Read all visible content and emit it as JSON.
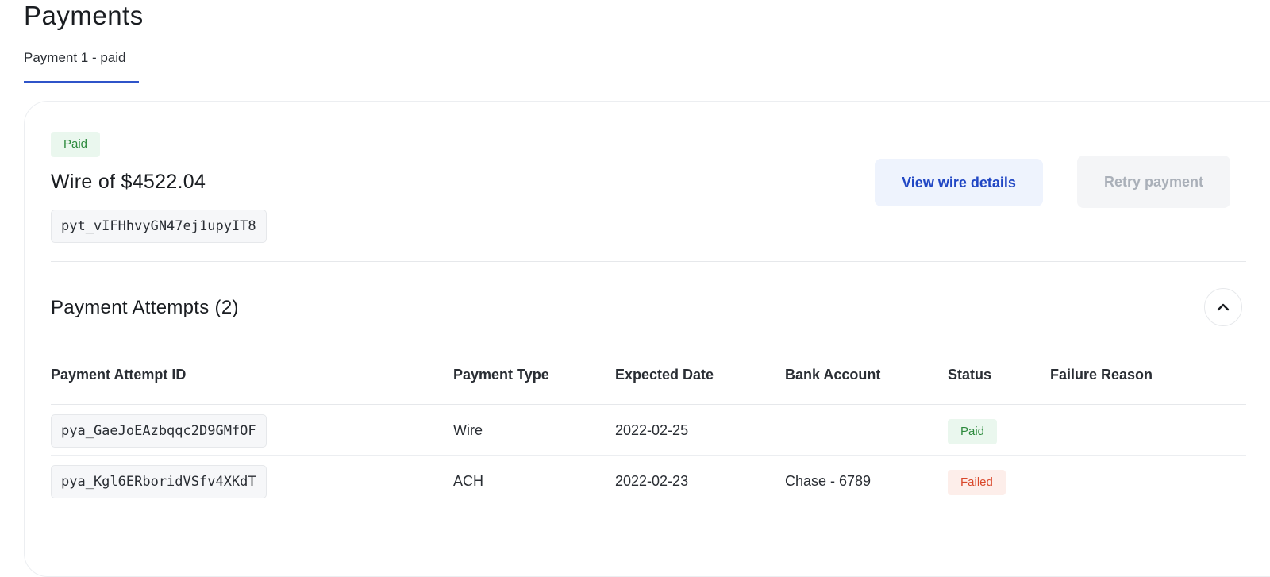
{
  "page": {
    "title": "Payments"
  },
  "tabs": [
    {
      "label": "Payment 1 - paid",
      "active": true
    }
  ],
  "payment": {
    "status": "Paid",
    "heading": "Wire of $4522.04",
    "id": "pyt_vIFHhvyGN47ej1upyIT8",
    "view_button": "View wire details",
    "retry_button": "Retry payment"
  },
  "attempts": {
    "title": "Payment Attempts (2)",
    "collapse_icon": "chevron-up-icon",
    "columns": [
      "Payment Attempt ID",
      "Payment Type",
      "Expected Date",
      "Bank Account",
      "Status",
      "Failure Reason"
    ],
    "rows": [
      {
        "id": "pya_GaeJoEAzbqqc2D9GMfOF",
        "type": "Wire",
        "date": "2022-02-25",
        "bank": "",
        "status": "Paid",
        "failure": ""
      },
      {
        "id": "pya_Kgl6ERboridVSfv4XKdT",
        "type": "ACH",
        "date": "2022-02-23",
        "bank": "Chase - 6789",
        "status": "Failed",
        "failure": ""
      }
    ]
  },
  "colors": {
    "accent": "#2f54c9",
    "paid_bg": "#eaf7ee",
    "paid_text": "#2d8a3d",
    "failed_bg": "#fdeeea",
    "failed_text": "#d9482b"
  }
}
